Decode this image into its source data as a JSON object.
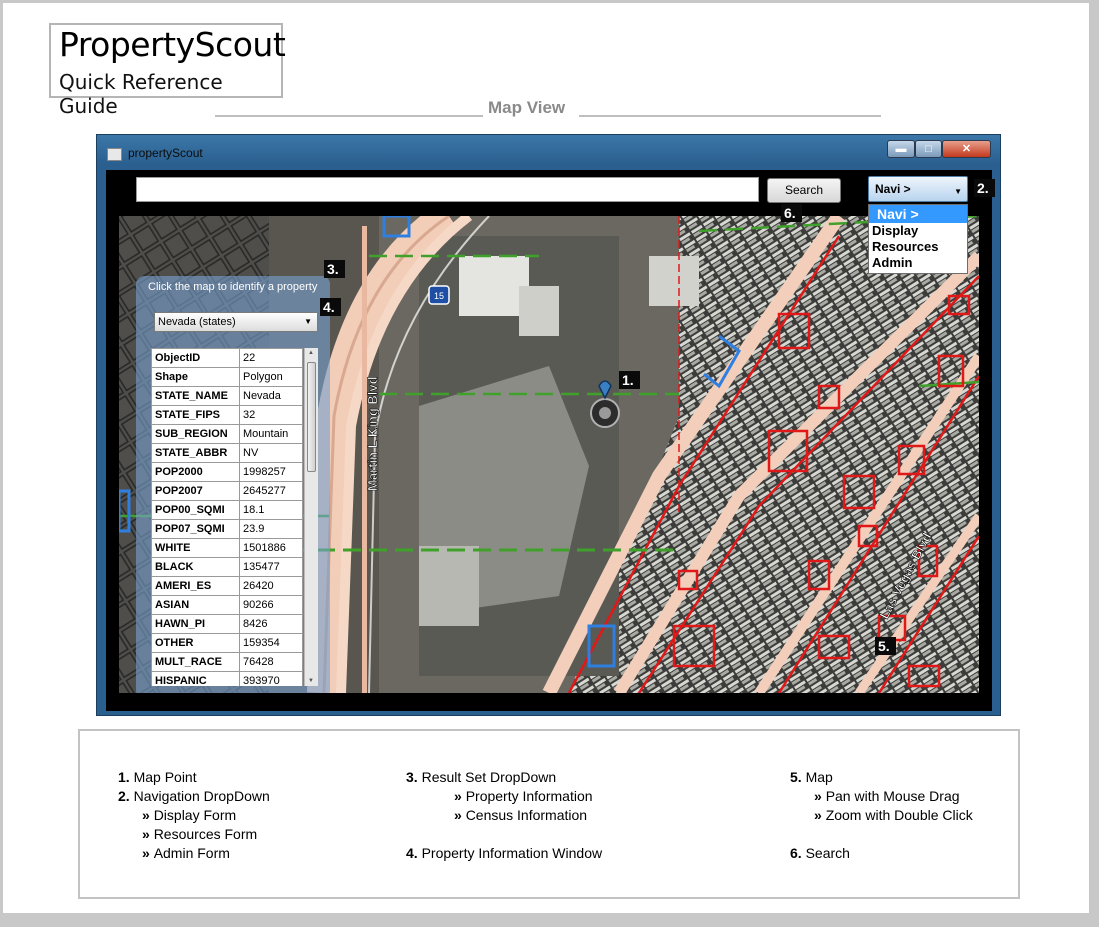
{
  "doc": {
    "title": "PropertyScout",
    "subtitle": "Quick Reference Guide",
    "section_title": "Map View"
  },
  "window": {
    "title": "propertyScout",
    "search_value": "",
    "search_button": "Search",
    "nav": {
      "selected": "Navi >",
      "options": [
        "Navi >",
        "Display",
        "Resources",
        "Admin"
      ]
    },
    "map": {
      "road_labels": [
        "Martin L King Blvd",
        "Las Vegas Blvd"
      ],
      "shield": "15"
    },
    "info_panel": {
      "hint": "Click the map to identify a property",
      "result_set": "Nevada (states)",
      "rows": [
        {
          "key": "ObjectID",
          "value": "22"
        },
        {
          "key": "Shape",
          "value": "Polygon"
        },
        {
          "key": "STATE_NAME",
          "value": "Nevada"
        },
        {
          "key": "STATE_FIPS",
          "value": "32"
        },
        {
          "key": "SUB_REGION",
          "value": "Mountain"
        },
        {
          "key": "STATE_ABBR",
          "value": "NV"
        },
        {
          "key": "POP2000",
          "value": "1998257"
        },
        {
          "key": "POP2007",
          "value": "2645277"
        },
        {
          "key": "POP00_SQMI",
          "value": "18.1"
        },
        {
          "key": "POP07_SQMI",
          "value": "23.9"
        },
        {
          "key": "WHITE",
          "value": "1501886"
        },
        {
          "key": "BLACK",
          "value": "135477"
        },
        {
          "key": "AMERI_ES",
          "value": "26420"
        },
        {
          "key": "ASIAN",
          "value": "90266"
        },
        {
          "key": "HAWN_PI",
          "value": "8426"
        },
        {
          "key": "OTHER",
          "value": "159354"
        },
        {
          "key": "MULT_RACE",
          "value": "76428"
        },
        {
          "key": "HISPANIC",
          "value": "393970"
        }
      ]
    },
    "callouts": [
      "1.",
      "2.",
      "3.",
      "4.",
      "5.",
      "6."
    ]
  },
  "legend": {
    "col1": [
      {
        "num": "1.",
        "text": "Map Point"
      },
      {
        "num": "2.",
        "text": "Navigation DropDown"
      },
      {
        "sub": "Display Form"
      },
      {
        "sub": "Resources Form"
      },
      {
        "sub": "Admin Form"
      }
    ],
    "col2": [
      {
        "num": "3.",
        "text": "Result Set DropDown"
      },
      {
        "sub": "Property Information"
      },
      {
        "sub": "Census Information"
      },
      {
        "num": "4.",
        "text": "Property Information Window"
      }
    ],
    "col3": [
      {
        "num": "5.",
        "text": "Map"
      },
      {
        "sub": "Pan with Mouse Drag"
      },
      {
        "sub": "Zoom with Double Click"
      },
      {
        "num": "6.",
        "text": "Search"
      }
    ]
  },
  "colors": {
    "window_frame": "#2a6090",
    "nav_highlight": "#3399ff",
    "parcel_red": "#e01818",
    "parcel_blue": "#2f7fe0",
    "road_green": "#3fa02a",
    "section_gray": "#8a8a8a"
  }
}
